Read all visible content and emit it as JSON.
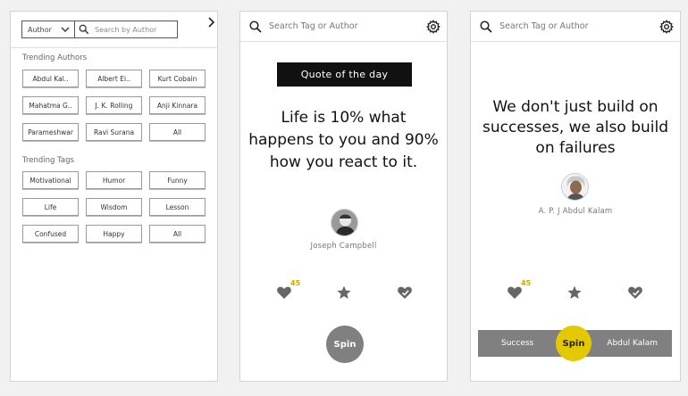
{
  "browse": {
    "filter_label": "Author",
    "search_placeholder": "Search by Author",
    "authors_title": "Trending Authors",
    "authors": [
      "Abdul Kal..",
      "Albert Ei..",
      "Kurt Cobain",
      "Mahatma G..",
      "J. K. Rolling",
      "Anji Kinnara",
      "Parameshwar",
      "Ravi Surana",
      "All"
    ],
    "tags_title": "Trending Tags",
    "tags": [
      "Motivational",
      "Humor",
      "Funny",
      "Life",
      "Wisdom",
      "Lesson",
      "Confused",
      "Happy",
      "All"
    ]
  },
  "quote_screen": {
    "search_text": "Search Tag or Author",
    "badge": "Quote of the day",
    "quote": "Life is 10% what happens to you and 90% how you react to it.",
    "author": "Joseph Campbell",
    "like_count": "45",
    "spin_label": "Spin"
  },
  "spin_screen": {
    "search_text": "Search Tag or Author",
    "quote": "We don't just build on successes, we also build on failures",
    "author": "A. P. J Abdul Kalam",
    "like_count": "45",
    "left_option": "Success",
    "spin_label": "Spin",
    "right_option": "Abdul Kalam"
  },
  "colors": {
    "accent_yellow": "#e5c900",
    "like_count": "#c9a800",
    "badge_bg": "#111111",
    "spin_gray": "#808080"
  }
}
